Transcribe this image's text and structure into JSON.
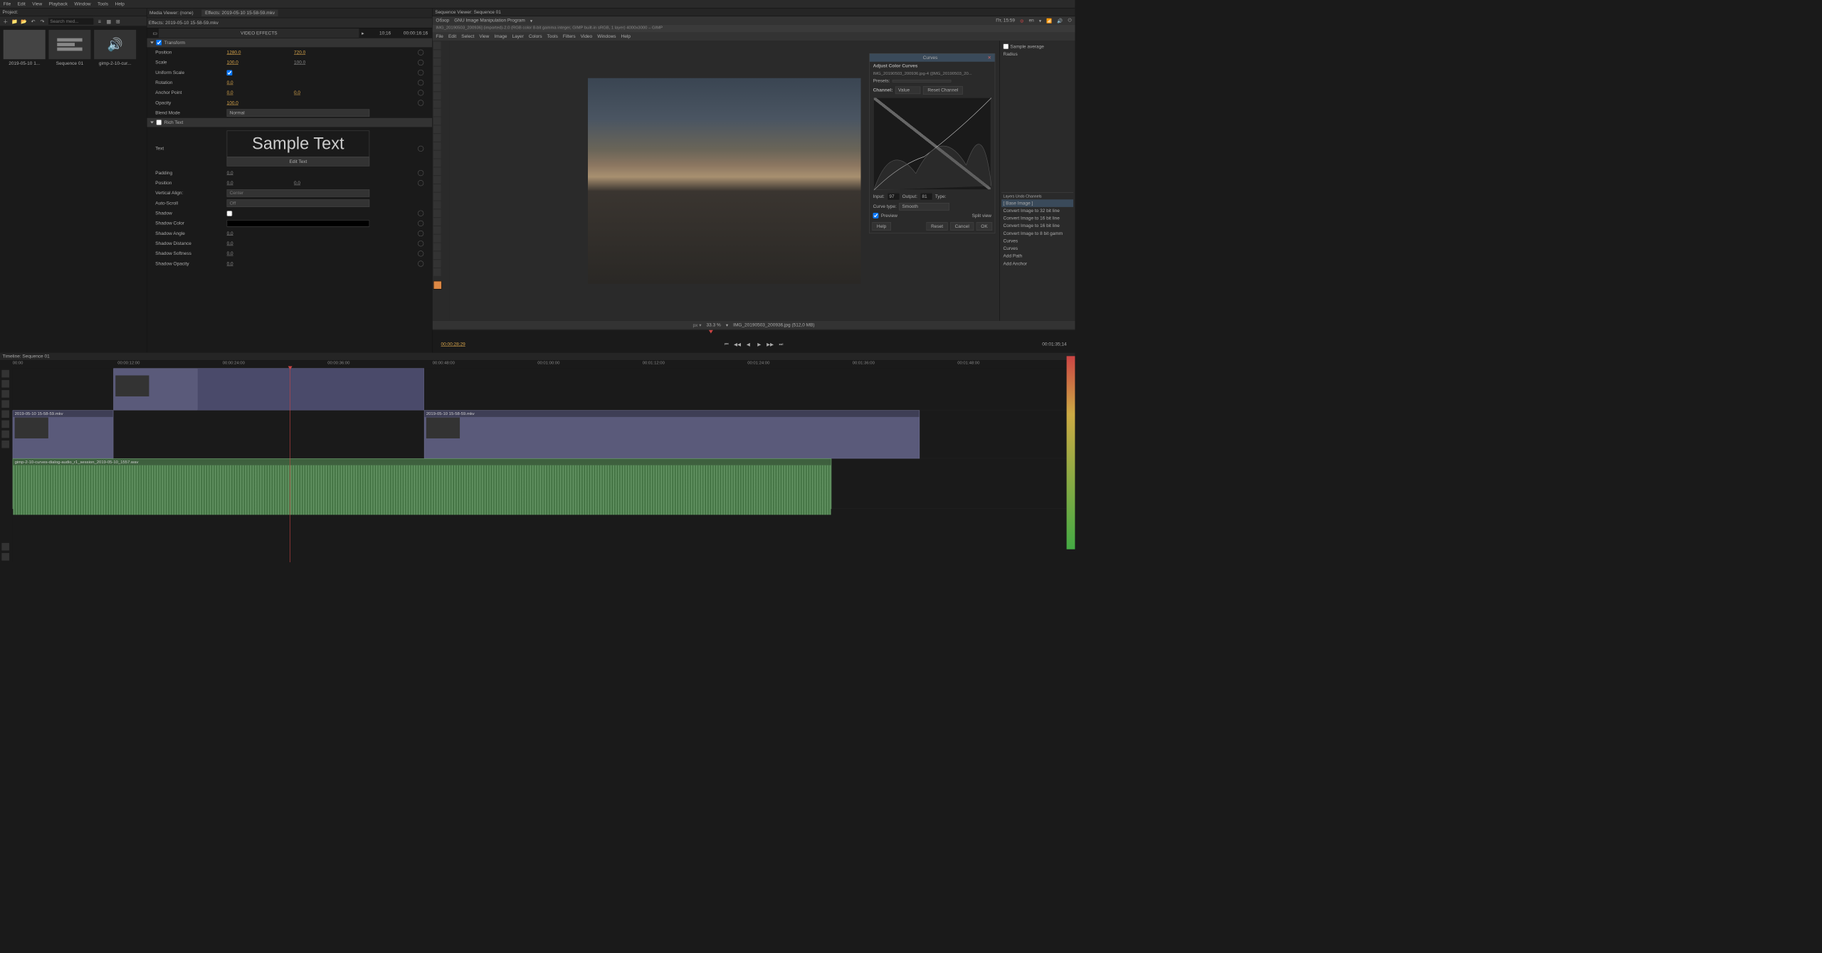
{
  "menu": {
    "file": "File",
    "edit": "Edit",
    "view": "View",
    "playback": "Playback",
    "window": "Window",
    "tools": "Tools",
    "help": "Help"
  },
  "project": {
    "title": "Project:",
    "search_ph": "Search med...",
    "bins": [
      {
        "name": "2019-05-10 1..."
      },
      {
        "name": "Sequence 01"
      },
      {
        "name": "gimp-2-10-cur..."
      }
    ]
  },
  "media_viewer": "Media Viewer: (none)",
  "effects_tab": "Effects: 2019-05-10 15-58-59.mkv",
  "effects": {
    "file": "Effects: 2019-05-10 15-58-59.mkv",
    "title": "VIDEO EFFECTS",
    "tc1": "10;16",
    "tc2": "00:00:16:16",
    "transform": {
      "name": "Transform",
      "props": {
        "position": {
          "label": "Position",
          "v1": "1280.0",
          "v2": "720.0"
        },
        "scale": {
          "label": "Scale",
          "v1": "100.0",
          "v2": "100.0"
        },
        "uniform": {
          "label": "Uniform Scale"
        },
        "rotation": {
          "label": "Rotation",
          "v1": "0.0"
        },
        "anchor": {
          "label": "Anchor Point",
          "v1": "0.0",
          "v2": "0.0"
        },
        "opacity": {
          "label": "Opacity",
          "v1": "100.0"
        },
        "blend": {
          "label": "Blend Mode",
          "v": "Normal"
        }
      }
    },
    "richtext": {
      "name": "Rich Text",
      "sample": "Sample Text",
      "edit": "Edit Text",
      "props": {
        "text": {
          "label": "Text"
        },
        "padding": {
          "label": "Padding",
          "v1": "0.0"
        },
        "position": {
          "label": "Position",
          "v1": "0.0",
          "v2": "0.0"
        },
        "valign": {
          "label": "Vertical Align:",
          "v": "Center"
        },
        "autoscroll": {
          "label": "Auto-Scroll",
          "v": "Off"
        },
        "shadow": {
          "label": "Shadow"
        },
        "shadowcolor": {
          "label": "Shadow Color"
        },
        "shadowangle": {
          "label": "Shadow Angle",
          "v1": "0.0"
        },
        "shadowdist": {
          "label": "Shadow Distance",
          "v1": "0.0"
        },
        "shadowsoft": {
          "label": "Shadow Softness",
          "v1": "0.0"
        },
        "shadowop": {
          "label": "Shadow Opacity",
          "v1": "0.0"
        }
      }
    }
  },
  "sequence_viewer": "Sequence Viewer: Sequence 01",
  "gimp": {
    "topbar": {
      "obzor": "Обзор",
      "app": "GNU Image Manipulation Program",
      "time": "Пт, 15:59",
      "lang": "en"
    },
    "title": "IMG_20190503_200936] (imported)-2.0 (RGB color 8-bit gamma integer, GIMP built-in sRGB, 1 layer) 4000x3000 – GIMP",
    "menu": {
      "file": "File",
      "edit": "Edit",
      "select": "Select",
      "view": "View",
      "image": "Image",
      "layer": "Layer",
      "colors": "Colors",
      "tools": "Tools",
      "filters": "Filters",
      "video": "Video",
      "windows": "Windows",
      "help": "Help"
    },
    "status": {
      "zoom": "33.3 %",
      "file": "IMG_20190503_200936.jpg (512,0 MB)"
    },
    "right_top": {
      "sample": "Sample average",
      "radius": "Radius"
    },
    "curves": {
      "title": "Curves",
      "adjust": "Adjust Color Curves",
      "sub": "IMG_20190503_200936.jpg-4 ([IMG_20190503_20...",
      "presets": "Presets:",
      "channel": "Channel:",
      "channel_v": "Value",
      "reset_ch": "Reset Channel",
      "input": "Input:",
      "input_v": "97",
      "output": "Output:",
      "output_v": "81",
      "type": "Type:",
      "curvetype": "Curve type:",
      "curvetype_v": "Smooth",
      "preview": "Preview",
      "split": "Split view",
      "help": "Help",
      "reset": "Reset",
      "cancel": "Cancel",
      "ok": "OK"
    },
    "right_panel": {
      "tabs": "Layers  Undo  Channels",
      "base": "[ Base Image ]",
      "items": [
        "Convert Image to 32 bit line",
        "Convert Image to 16 bit line",
        "Convert Image to 16 bit line",
        "Convert Image to 8 bit gamm",
        "Curves",
        "Curves",
        "Add Path",
        "Add Anchor"
      ]
    }
  },
  "transport": {
    "curr": "00:00:28;29",
    "dur": "00:01:35;14"
  },
  "timeline": {
    "title": "Timeline: Sequence 01",
    "ticks": [
      "00:00",
      "00:00:12:00",
      "00:00:24:00",
      "00:00:36:00",
      "00:00:48:00",
      "00:01:00:00",
      "00:01:12:00",
      "00:01:24:00",
      "00:01:36:00",
      "00:01:48:00"
    ],
    "clips": {
      "v2": {
        "label": "2019-05-10 15-58-59.mkv"
      },
      "v2b": {
        "label": "2019-05-10 15-58-59.mkv"
      },
      "a": {
        "label": "gimp-2-10-curves-dialog-audio_r1_session_2019-05-10_1557.wav"
      }
    }
  }
}
